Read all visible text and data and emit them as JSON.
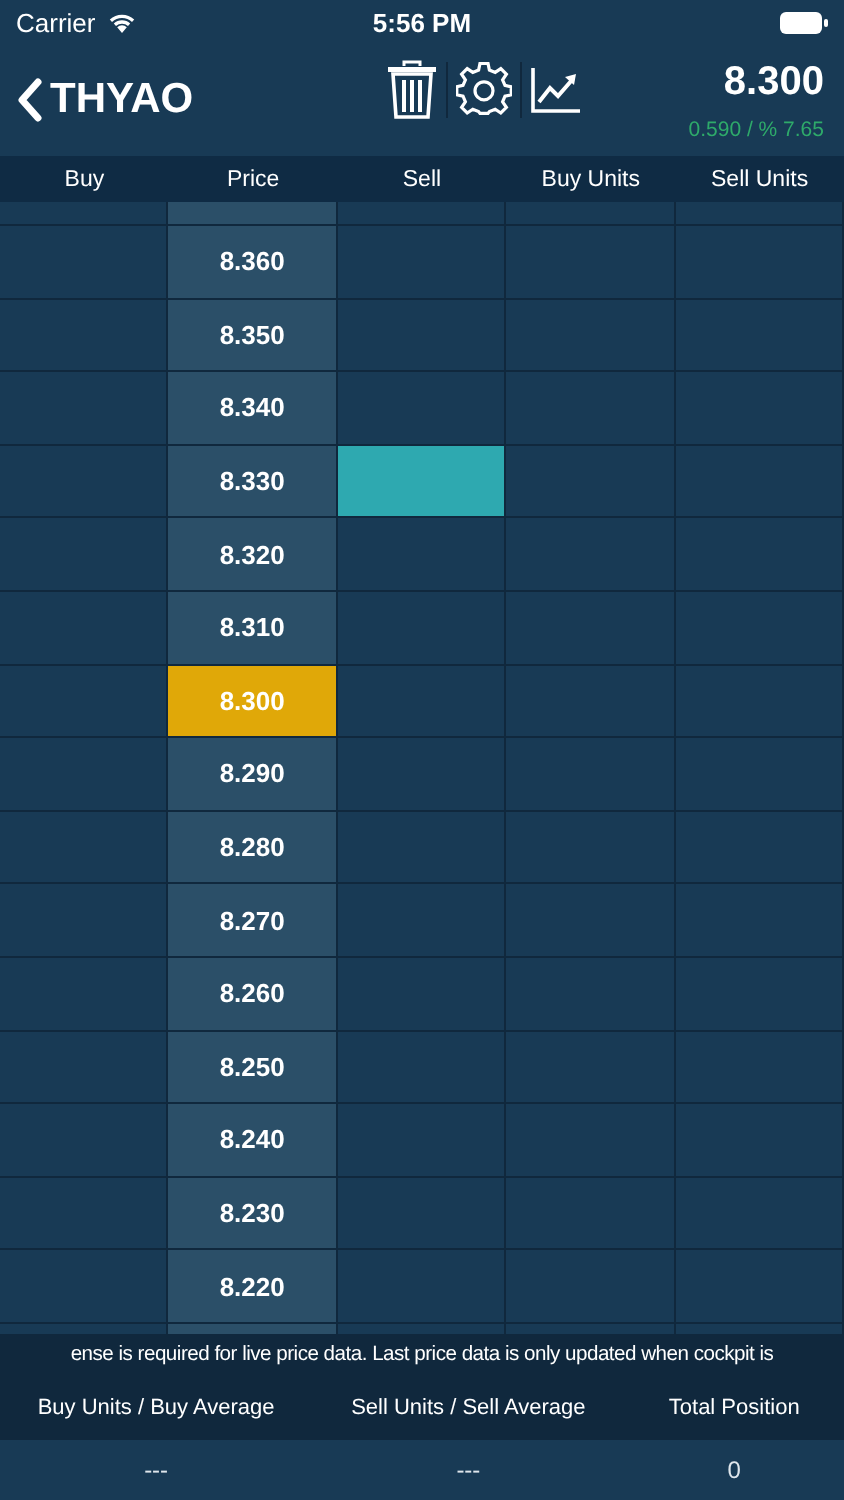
{
  "status_bar": {
    "carrier": "Carrier",
    "time": "5:56 PM"
  },
  "header": {
    "back_symbol": "THYAO",
    "price": "8.300",
    "change": "0.590 / % 7.65"
  },
  "columns": [
    "Buy",
    "Price",
    "Sell",
    "Buy Units",
    "Sell Units"
  ],
  "rows": [
    {
      "price": "8.360",
      "current": false,
      "sell_marked": false
    },
    {
      "price": "8.350",
      "current": false,
      "sell_marked": false
    },
    {
      "price": "8.340",
      "current": false,
      "sell_marked": false
    },
    {
      "price": "8.330",
      "current": false,
      "sell_marked": true
    },
    {
      "price": "8.320",
      "current": false,
      "sell_marked": false
    },
    {
      "price": "8.310",
      "current": false,
      "sell_marked": false
    },
    {
      "price": "8.300",
      "current": true,
      "sell_marked": false
    },
    {
      "price": "8.290",
      "current": false,
      "sell_marked": false
    },
    {
      "price": "8.280",
      "current": false,
      "sell_marked": false
    },
    {
      "price": "8.270",
      "current": false,
      "sell_marked": false
    },
    {
      "price": "8.260",
      "current": false,
      "sell_marked": false
    },
    {
      "price": "8.250",
      "current": false,
      "sell_marked": false
    },
    {
      "price": "8.240",
      "current": false,
      "sell_marked": false
    },
    {
      "price": "8.230",
      "current": false,
      "sell_marked": false
    },
    {
      "price": "8.220",
      "current": false,
      "sell_marked": false
    }
  ],
  "notice": "ense is required for live price data. Last price data is only updated when cockpit is",
  "summary": {
    "columns": [
      "Buy Units / Buy Average",
      "Sell Units / Sell Average",
      "Total Position"
    ],
    "values": [
      "---",
      "---",
      "0"
    ]
  }
}
